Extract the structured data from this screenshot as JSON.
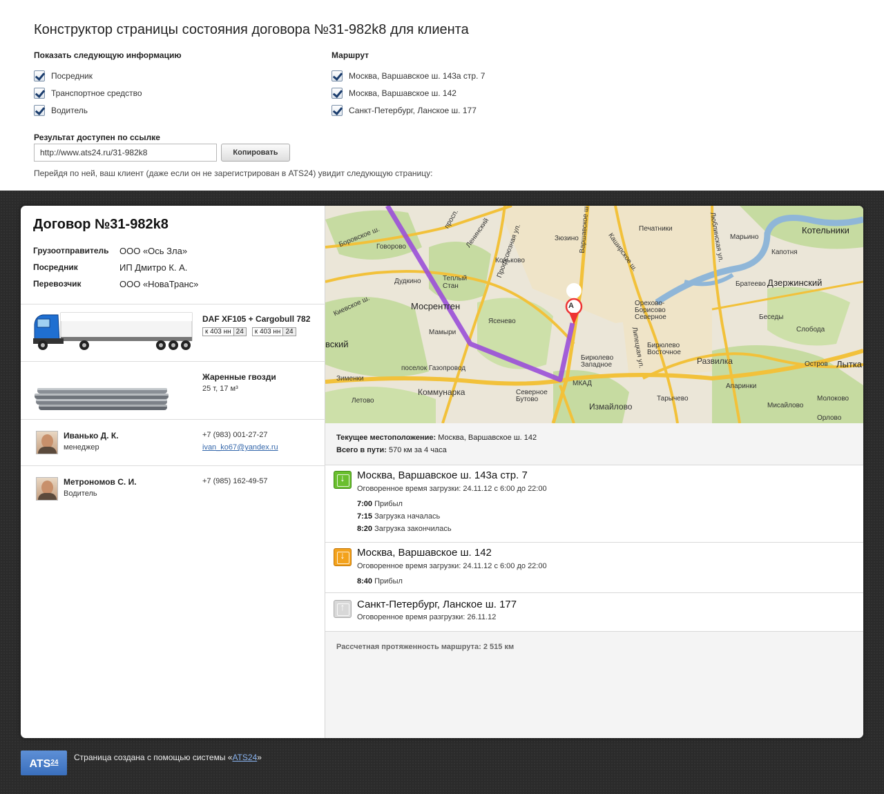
{
  "builder": {
    "title": "Конструктор страницы состояния договора №31-982k8 для клиента",
    "show_header": "Показать следующую информацию",
    "show_items": [
      "Посредник",
      "Транспортное средство",
      "Водитель"
    ],
    "route_header": "Маршрут",
    "route_items": [
      "Москва, Варшавское ш. 143а стр. 7",
      "Москва, Варшавское ш. 142",
      "Санкт-Петербург, Ланское ш. 177"
    ],
    "link_label": "Результат доступен по ссылке",
    "link_value": "http://www.ats24.ru/31-982k8",
    "copy_label": "Копировать",
    "hint": "Перейдя по ней, ваш клиент (даже если он не зарегистрирован в ATS24) увидит следующую страницу:"
  },
  "contract": {
    "title": "Договор №31-982k8",
    "fields": [
      {
        "key": "Грузоотправитель",
        "value": "ООО «Ось Зла»"
      },
      {
        "key": "Посредник",
        "value": "ИП Дмитро К. А."
      },
      {
        "key": "Перевозчик",
        "value": "ООО «НоваТранс»"
      }
    ]
  },
  "vehicle": {
    "title": "DAF XF105 + Cargobull 782",
    "plates": [
      {
        "num": "к 403 нн",
        "region": "24"
      },
      {
        "num": "к 403 нн",
        "region": "24"
      }
    ]
  },
  "cargo": {
    "title": "Жаренные гвозди",
    "details": "25 т, 17 м³"
  },
  "people": [
    {
      "name": "Иванько Д. К.",
      "role": "менеджер",
      "phone": "+7 (983) 001-27-27",
      "email": "ivan_ko67@yandex.ru"
    },
    {
      "name": "Метрономов С. И.",
      "role": "Водитель",
      "phone": "+7 (985) 162-49-57",
      "email": ""
    }
  ],
  "map": {
    "marker": "A",
    "labels": [
      "Котельники",
      "Дзержинский",
      "Говорово",
      "Мосрентген",
      "Дудкино",
      "Теплый Стан",
      "Коньково",
      "Ясенево",
      "Мамыри",
      "поселок Газопровод",
      "Зименки",
      "Коммунарка",
      "Летово",
      "Северное Бутово",
      "МКАД",
      "Измайлово",
      "Бирюлево Западное",
      "Бирюлево Восточное",
      "Орехово-Борисово Северное",
      "Развилка",
      "Апаринки",
      "Тарычево",
      "Мисайлово",
      "Молоково",
      "Остров",
      "Слобода",
      "Беседы",
      "Братеево",
      "Капотня",
      "Марьино",
      "Печатники",
      "Лытка",
      "Зюзино",
      "Ленинский",
      "Боровское ш.",
      "Киевское ш.",
      "Профсоюзная ул.",
      "Варшавское ш.",
      "Каширское ш.",
      "Липецкая ул.",
      "Люблинская ул.",
      "просп.",
      "вский",
      "Орлово"
    ]
  },
  "status": {
    "location_label": "Текущее местоположение:",
    "location_value": "Москва, Варшавское ш. 142",
    "total_label": "Всего в пути:",
    "total_value": "570 км за 4 часа"
  },
  "stops": [
    {
      "title": "Москва, Варшавское ш. 143а стр. 7",
      "sub": "Оговоренное время загрузки: 24.11.12 с 6:00 до 22:00",
      "events": [
        {
          "time": "7:00",
          "text": "Прибыл"
        },
        {
          "time": "7:15",
          "text": "Загрузка началась"
        },
        {
          "time": "8:20",
          "text": "Загрузка закончилась"
        }
      ]
    },
    {
      "title": "Москва, Варшавское ш. 142",
      "sub": "Оговоренное время загрузки: 24.11.12 с 6:00 до 22:00",
      "events": [
        {
          "time": "8:40",
          "text": "Прибыл"
        }
      ]
    },
    {
      "title": "Санкт-Петербург, Ланское ш. 177",
      "sub": "Оговоренное время разгрузки: 26.11.12",
      "events": []
    }
  ],
  "route_length": "Рассчетная протяженность маршрута: 2 515 км",
  "footer": {
    "logo": "ATS",
    "logo_sup": "24",
    "text_before": "Страница создана с помощью системы «",
    "link": "ATS24",
    "text_after": "»"
  },
  "colors": {
    "route": "#9a4fd8",
    "accent": "#3a6fbd",
    "dark_bg": "#2b2b2b"
  }
}
